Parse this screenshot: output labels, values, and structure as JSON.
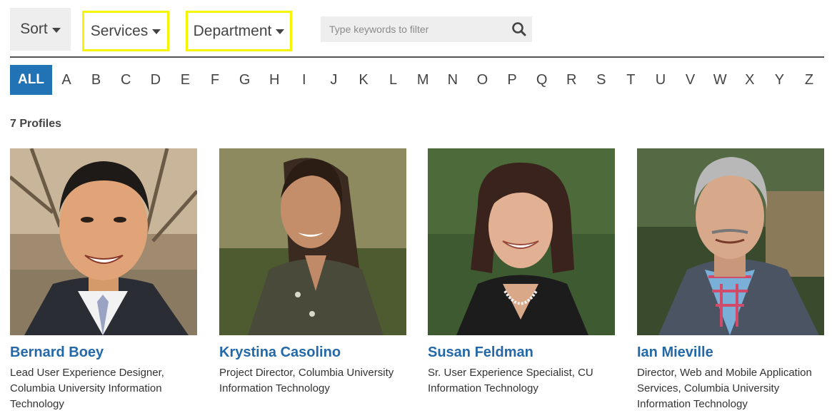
{
  "filters": {
    "sort_label": "Sort",
    "services_label": "Services",
    "department_label": "Department",
    "search_placeholder": "Type keywords to filter"
  },
  "alphabet": {
    "all_label": "ALL",
    "letters": [
      "A",
      "B",
      "C",
      "D",
      "E",
      "F",
      "G",
      "H",
      "I",
      "J",
      "K",
      "L",
      "M",
      "N",
      "O",
      "P",
      "Q",
      "R",
      "S",
      "T",
      "U",
      "V",
      "W",
      "X",
      "Y",
      "Z"
    ]
  },
  "results": {
    "count_label": "7 Profiles"
  },
  "profiles": [
    {
      "name": "Bernard Boey",
      "title": "Lead User Experience Designer, Columbia University Information Technology"
    },
    {
      "name": "Krystina Casolino",
      "title": "Project Director, Columbia University Information Technology"
    },
    {
      "name": "Susan Feldman",
      "title": "Sr. User Experience Specialist, CU Information Technology"
    },
    {
      "name": "Ian Mieville",
      "title": "Director, Web and Mobile Application Services, Columbia University Information Technology"
    }
  ],
  "colors": {
    "accent": "#2272b6",
    "link": "#2468a8",
    "highlight": "#f5f500"
  }
}
